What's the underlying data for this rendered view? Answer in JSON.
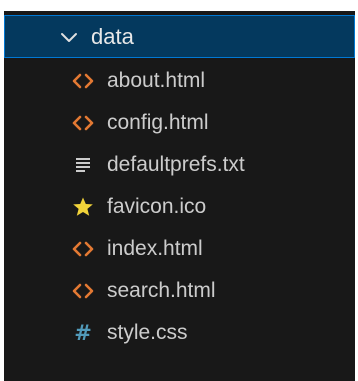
{
  "explorer": {
    "folder": {
      "name": "data",
      "expanded": true
    },
    "files": [
      {
        "name": "about.html",
        "icon": "html-icon"
      },
      {
        "name": "config.html",
        "icon": "html-icon"
      },
      {
        "name": "defaultprefs.txt",
        "icon": "text-file-icon"
      },
      {
        "name": "favicon.ico",
        "icon": "star-icon"
      },
      {
        "name": "index.html",
        "icon": "html-icon"
      },
      {
        "name": "search.html",
        "icon": "html-icon"
      },
      {
        "name": "style.css",
        "icon": "css-hash-icon"
      }
    ]
  },
  "colors": {
    "panel_background": "#181818",
    "selection_background": "#04395e",
    "selection_border": "#0078d4",
    "html_icon": "#e37933",
    "text_icon": "#cccccc",
    "star_icon": "#f1d33a",
    "css_icon": "#519aba"
  }
}
